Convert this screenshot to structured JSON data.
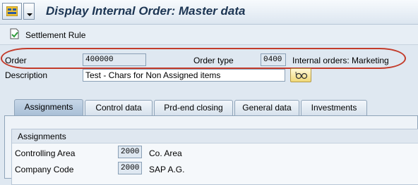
{
  "header": {
    "title": "Display Internal Order: Master data"
  },
  "toolbar": {
    "settlement_rule_label": "Settlement Rule"
  },
  "order_fields": {
    "order_label": "Order",
    "order_value": "400000",
    "order_type_label": "Order type",
    "order_type_value": "0400",
    "order_type_text": "Internal orders: Marketing",
    "description_label": "Description",
    "description_value": "Test - Chars for Non Assigned items"
  },
  "tabs": [
    {
      "label": "Assignments",
      "active": true
    },
    {
      "label": "Control data",
      "active": false
    },
    {
      "label": "Prd-end closing",
      "active": false
    },
    {
      "label": "General data",
      "active": false
    },
    {
      "label": "Investments",
      "active": false
    }
  ],
  "assignments": {
    "group_title": "Assignments",
    "rows": [
      {
        "label": "Controlling Area",
        "value": "2000",
        "text": "Co. Area"
      },
      {
        "label": "Company Code",
        "value": "2000",
        "text": "SAP A.G."
      }
    ]
  },
  "colors": {
    "highlight": "#c33b2a",
    "title": "#1c3553",
    "background": "#dfe8f1"
  }
}
